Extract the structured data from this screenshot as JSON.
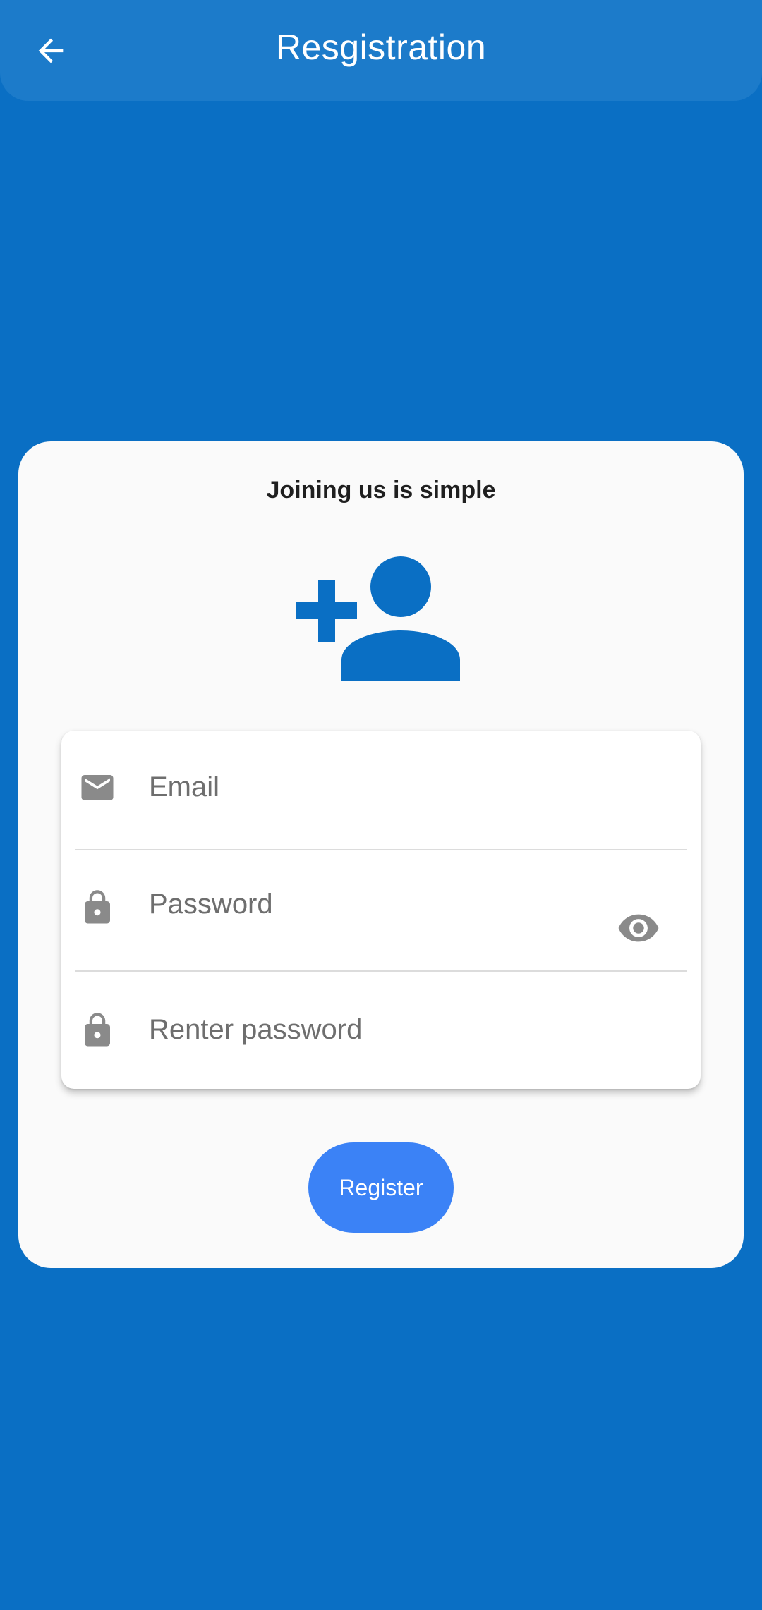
{
  "app_bar": {
    "title": "Resgistration",
    "back_icon": "arrow-back-icon"
  },
  "card": {
    "heading": "Joining us is simple",
    "hero_icon": "person-add-icon"
  },
  "form": {
    "email": {
      "icon": "mail-icon",
      "placeholder": "Email",
      "value": ""
    },
    "password": {
      "icon": "lock-icon",
      "placeholder": "Password",
      "value": "",
      "toggle_icon": "eye-icon"
    },
    "reenter_password": {
      "icon": "lock-icon",
      "placeholder": "Renter password",
      "value": ""
    }
  },
  "register_button": {
    "label": "Register"
  },
  "colors": {
    "background": "#0a6fc4",
    "app_bar": "#1c7bca",
    "card": "#fafafa",
    "accent_icon": "#0a6fc4",
    "button": "#3b82f6",
    "field_icon": "#8a8a8a"
  }
}
